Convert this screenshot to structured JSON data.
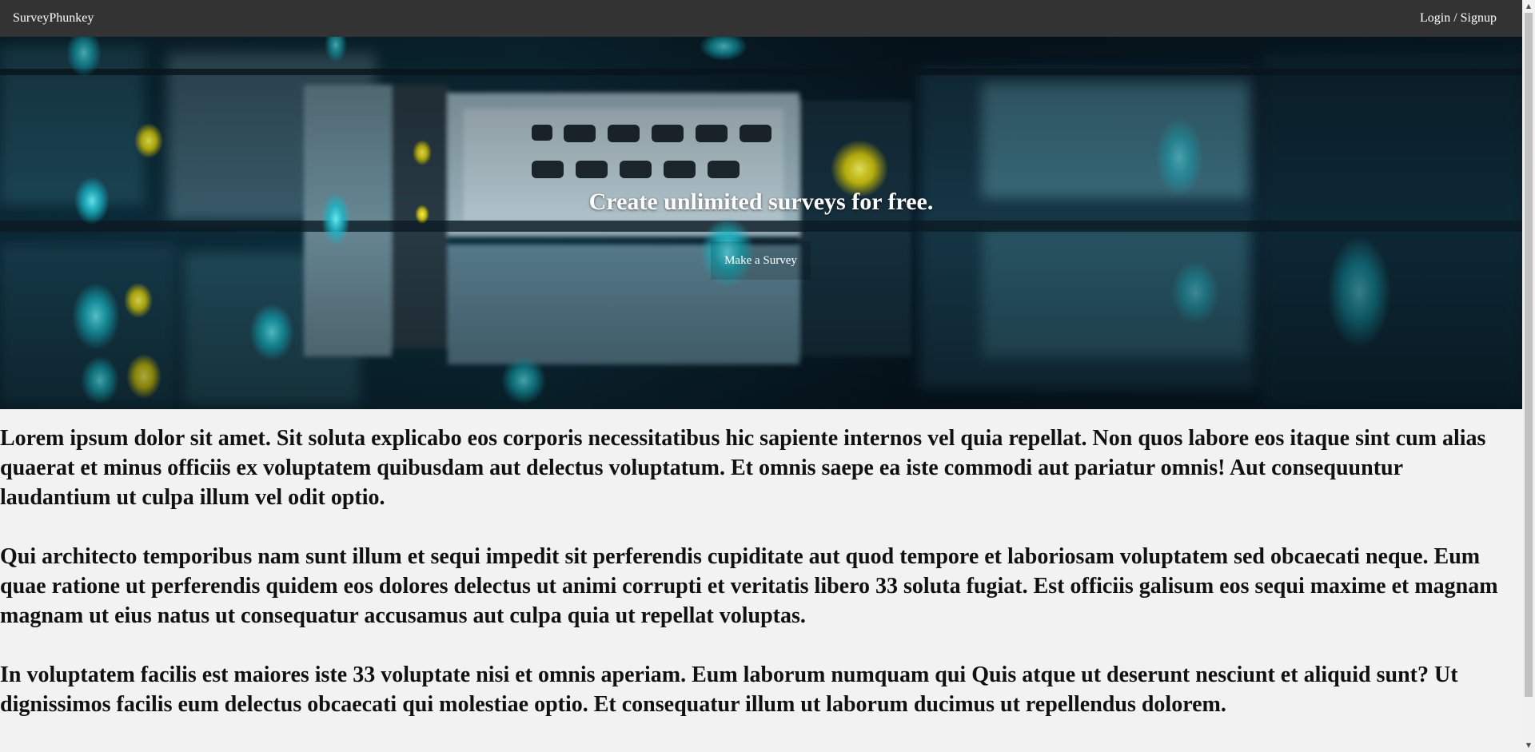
{
  "navbar": {
    "brand": "SurveyPhunkey",
    "login_label": "Login / Signup"
  },
  "hero": {
    "title": "Create unlimited surveys for free.",
    "button_label": "Make a Survey",
    "background": "server-rack-photo"
  },
  "content": {
    "paragraphs": [
      "Lorem ipsum dolor sit amet. Sit soluta explicabo eos corporis necessitatibus hic sapiente internos vel quia repellat. Non quos labore eos itaque sint cum alias quaerat et minus officiis ex voluptatem quibusdam aut delectus voluptatum. Et omnis saepe ea iste commodi aut pariatur omnis! Aut consequuntur laudantium ut culpa illum vel odit optio.",
      "Qui architecto temporibus nam sunt illum et sequi impedit sit perferendis cupiditate aut quod tempore et laboriosam voluptatem sed obcaecati neque. Eum quae ratione ut perferendis quidem eos dolores delectus ut animi corrupti et veritatis libero 33 soluta fugiat. Est officiis galisum eos sequi maxime et magnam magnam ut eius natus ut consequatur accusamus aut culpa quia ut repellat voluptas.",
      "In voluptatem facilis est maiores iste 33 voluptate nisi et omnis aperiam. Eum laborum numquam qui Quis atque ut deserunt nesciunt et aliquid sunt? Ut dignissimos facilis eum delectus obcaecati qui molestiae optio. Et consequatur illum ut laborum ducimus ut repellendus dolorem."
    ]
  },
  "colors": {
    "navbar_bg": "#333333",
    "page_bg": "#f2f2f2",
    "hero_accent": "#19c8d8"
  }
}
